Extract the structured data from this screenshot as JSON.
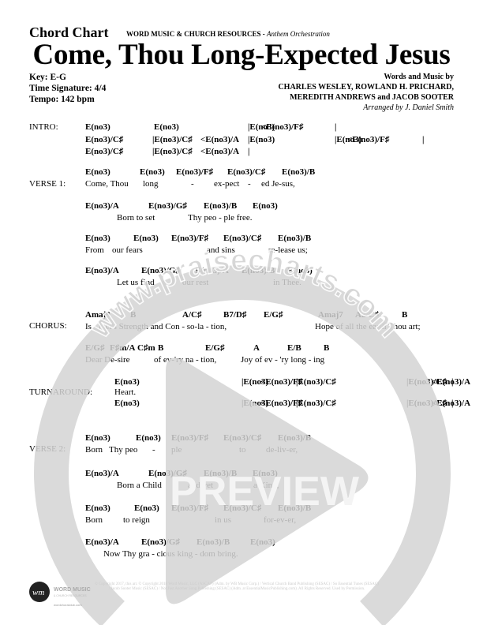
{
  "header": {
    "chart_type": "Chord Chart",
    "publisher": "WORD MUSIC & CHURCH RESOURCES",
    "edition": "Anthem Orchestration",
    "title": "Come, Thou Long-Expected Jesus",
    "key": "Key: E-G",
    "time_signature": "Time Signature: 4/4",
    "tempo": "Tempo: 142 bpm",
    "credits_label": "Words and Music by",
    "credits_line1": "CHARLES WESLEY, ROWLAND H. PRICHARD,",
    "credits_line2": "MEREDITH ANDREWS and JACOB SOOTER",
    "arranger": "Arranged by J. Daniel Smith"
  },
  "sections": {
    "intro": {
      "label": "INTRO:",
      "rows": [
        [
          "E(no3)",
          "E(no3)",
          "|E(no3)",
          "<E(no3)/F♯",
          "|"
        ],
        [
          "E(no3)/C♯",
          "|E(no3)/C♯",
          "<E(no3)/A",
          "|E(no3)",
          "|E(no3)",
          "<E(no3)/F♯",
          "|"
        ],
        [
          "E(no3)/C♯",
          "|E(no3)/C♯",
          "<E(no3)/A",
          "|"
        ]
      ]
    },
    "verse1": {
      "label": "VERSE 1:",
      "lines": [
        {
          "chords": [
            "E(no3)",
            "E(no3)",
            "E(no3)/F♯",
            "E(no3)/C♯",
            "E(no3)/B"
          ],
          "lyrics": [
            "Come, Thou",
            "long",
            "-",
            "ex-pect",
            "-",
            "ed Je-sus,"
          ]
        },
        {
          "chords": [
            "E(no3)/A",
            "E(no3)/G♯",
            "E(no3)/B",
            "E(no3)"
          ],
          "lyrics": [
            "Born to set",
            "Thy peo - ple free."
          ]
        },
        {
          "chords": [
            "E(no3)",
            "E(no3)",
            "E(no3)/F♯",
            "E(no3)/C♯",
            "E(no3)/B"
          ],
          "lyrics": [
            "From",
            "our fears",
            "and sins",
            "re-lease us;"
          ]
        },
        {
          "chords": [
            "E(no3)/A",
            "E(no3)/G♯",
            "E(no3)/A",
            "E(no3)/B",
            "E(no3)"
          ],
          "lyrics": [
            "Let us find",
            "our rest",
            "in Thee."
          ]
        }
      ]
    },
    "chorus": {
      "label": "CHORUS:",
      "lines": [
        {
          "chords": [
            "Amaj9",
            "B",
            "A/C♯",
            "B7/D♯",
            "E/G♯",
            "Amaj7",
            "A2/C♯",
            "B"
          ],
          "lyrics": [
            "Is - rael's Strength and Con - so-la - tion,",
            "Hope of all the earth Thou art;"
          ]
        },
        {
          "chords": [
            "E/G♯",
            "F♯m/A",
            "C♯m",
            "B",
            "E/G♯",
            "A",
            "E/B",
            "B"
          ],
          "lyrics": [
            "Dear De-sire",
            "of ev-'ry na - tion,",
            "Joy of ev - 'ry long - ing"
          ]
        }
      ]
    },
    "turnaround": {
      "label": "TURNAROUND:",
      "lyric": "Heart.",
      "rows": [
        [
          "E(no3)",
          "|E(no3)",
          "<E(no3)/F♯",
          "|E(no3)/C♯",
          "|E(no3)/C♯",
          "<E(no3)/A",
          "|"
        ],
        [
          "E(no3)",
          "|E(no3)",
          "<E(no3)/F♯",
          "|E(no3)/C♯",
          "|E(no3)/C♯",
          "<E(no3)/A",
          "|"
        ]
      ]
    },
    "verse2": {
      "label": "VERSE 2:",
      "lines": [
        {
          "chords": [
            "E(no3)",
            "E(no3)",
            "E(no3)/F♯",
            "E(no3)/C♯",
            "E(no3)/B"
          ],
          "lyrics": [
            "Born",
            "Thy peo",
            "-",
            "ple",
            "to",
            "de-liv-er,"
          ]
        },
        {
          "chords": [
            "E(no3)/A",
            "E(no3)/G♯",
            "E(no3)/B",
            "E(no3)"
          ],
          "lyrics": [
            "Born a Child",
            "and yet",
            "a King,"
          ]
        },
        {
          "chords": [
            "E(no3)",
            "E(no3)",
            "E(no3)/F♯",
            "E(no3)/C♯",
            "E(no3)/B"
          ],
          "lyrics": [
            "Born",
            "to reign",
            "in us",
            "for-ev-er,"
          ]
        },
        {
          "chords": [
            "E(no3)/A",
            "E(no3)/G♯",
            "E(no3)/B",
            "E(no3)"
          ],
          "lyrics": [
            "Now Thy gra - cious king - dom bring."
          ]
        }
      ]
    }
  },
  "watermark": {
    "url": "www.praisecharts.com",
    "label": "PREVIEW",
    "color": "#d3d3d3"
  },
  "footer": {
    "logo_text": "WORD MUSIC",
    "logo_sub": "& CHURCH RESOURCES",
    "logo_url": "wordchoralclub.com",
    "copyright": "© Copyright 2017, this arr. © Copyright 2018 Word Music, LLC (ASCAP) (Adm. by WB Music Corp.) / Vertical Church Band Publishing (SESAC) / So Essential Tunes (SESAC) / Jacob Sooter Music (SESAC) / Not Just Another Song Publishing (SESAC) (Adm. at EssentialMusicPublishing.com). All Rights Reserved. Used by Permission."
  }
}
